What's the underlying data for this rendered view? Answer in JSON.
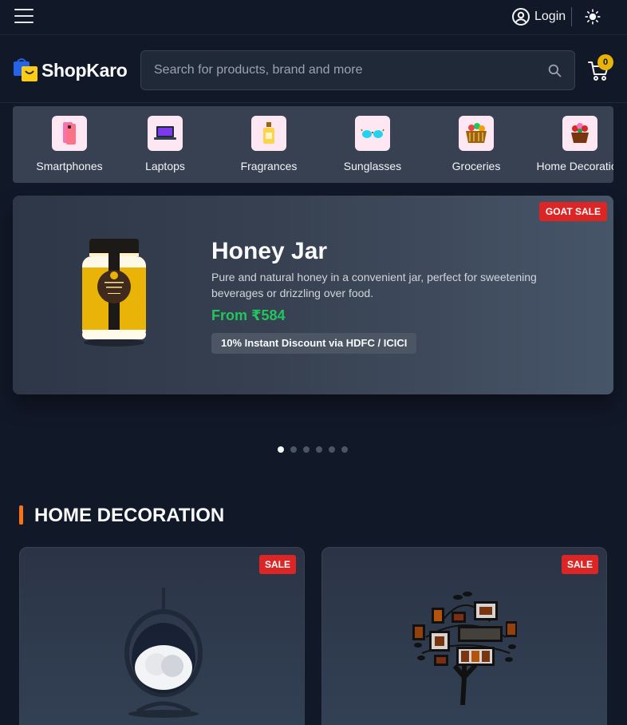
{
  "topbar": {
    "login_label": "Login"
  },
  "header": {
    "logo_text": "ShopKaro",
    "search_placeholder": "Search for products, brand and more",
    "cart_count": "0"
  },
  "categories": [
    {
      "label": "Smartphones",
      "icon": "smartphone-icon"
    },
    {
      "label": "Laptops",
      "icon": "laptop-icon"
    },
    {
      "label": "Fragrances",
      "icon": "perfume-icon"
    },
    {
      "label": "Sunglasses",
      "icon": "sunglasses-icon"
    },
    {
      "label": "Groceries",
      "icon": "grocery-basket-icon"
    },
    {
      "label": "Home Decoration",
      "icon": "flower-basket-icon"
    }
  ],
  "hero": {
    "badge": "GOAT SALE",
    "title": "Honey Jar",
    "description": "Pure and natural honey in a convenient jar, perfect for sweetening beverages or drizzling over food.",
    "price": "From ₹584",
    "offer": "10% Instant Discount via HDFC / ICICI",
    "slide_count": 6,
    "active_slide": 1
  },
  "section": {
    "title": "HOME DECORATION"
  },
  "products": [
    {
      "badge": "SALE",
      "image": "hanging-chair-image"
    },
    {
      "badge": "SALE",
      "image": "family-tree-frame-image"
    }
  ],
  "colors": {
    "background": "#111827",
    "accent": "#f97316",
    "price": "#22c55e",
    "sale_badge": "#dc2626",
    "cart_badge": "#eab308"
  }
}
